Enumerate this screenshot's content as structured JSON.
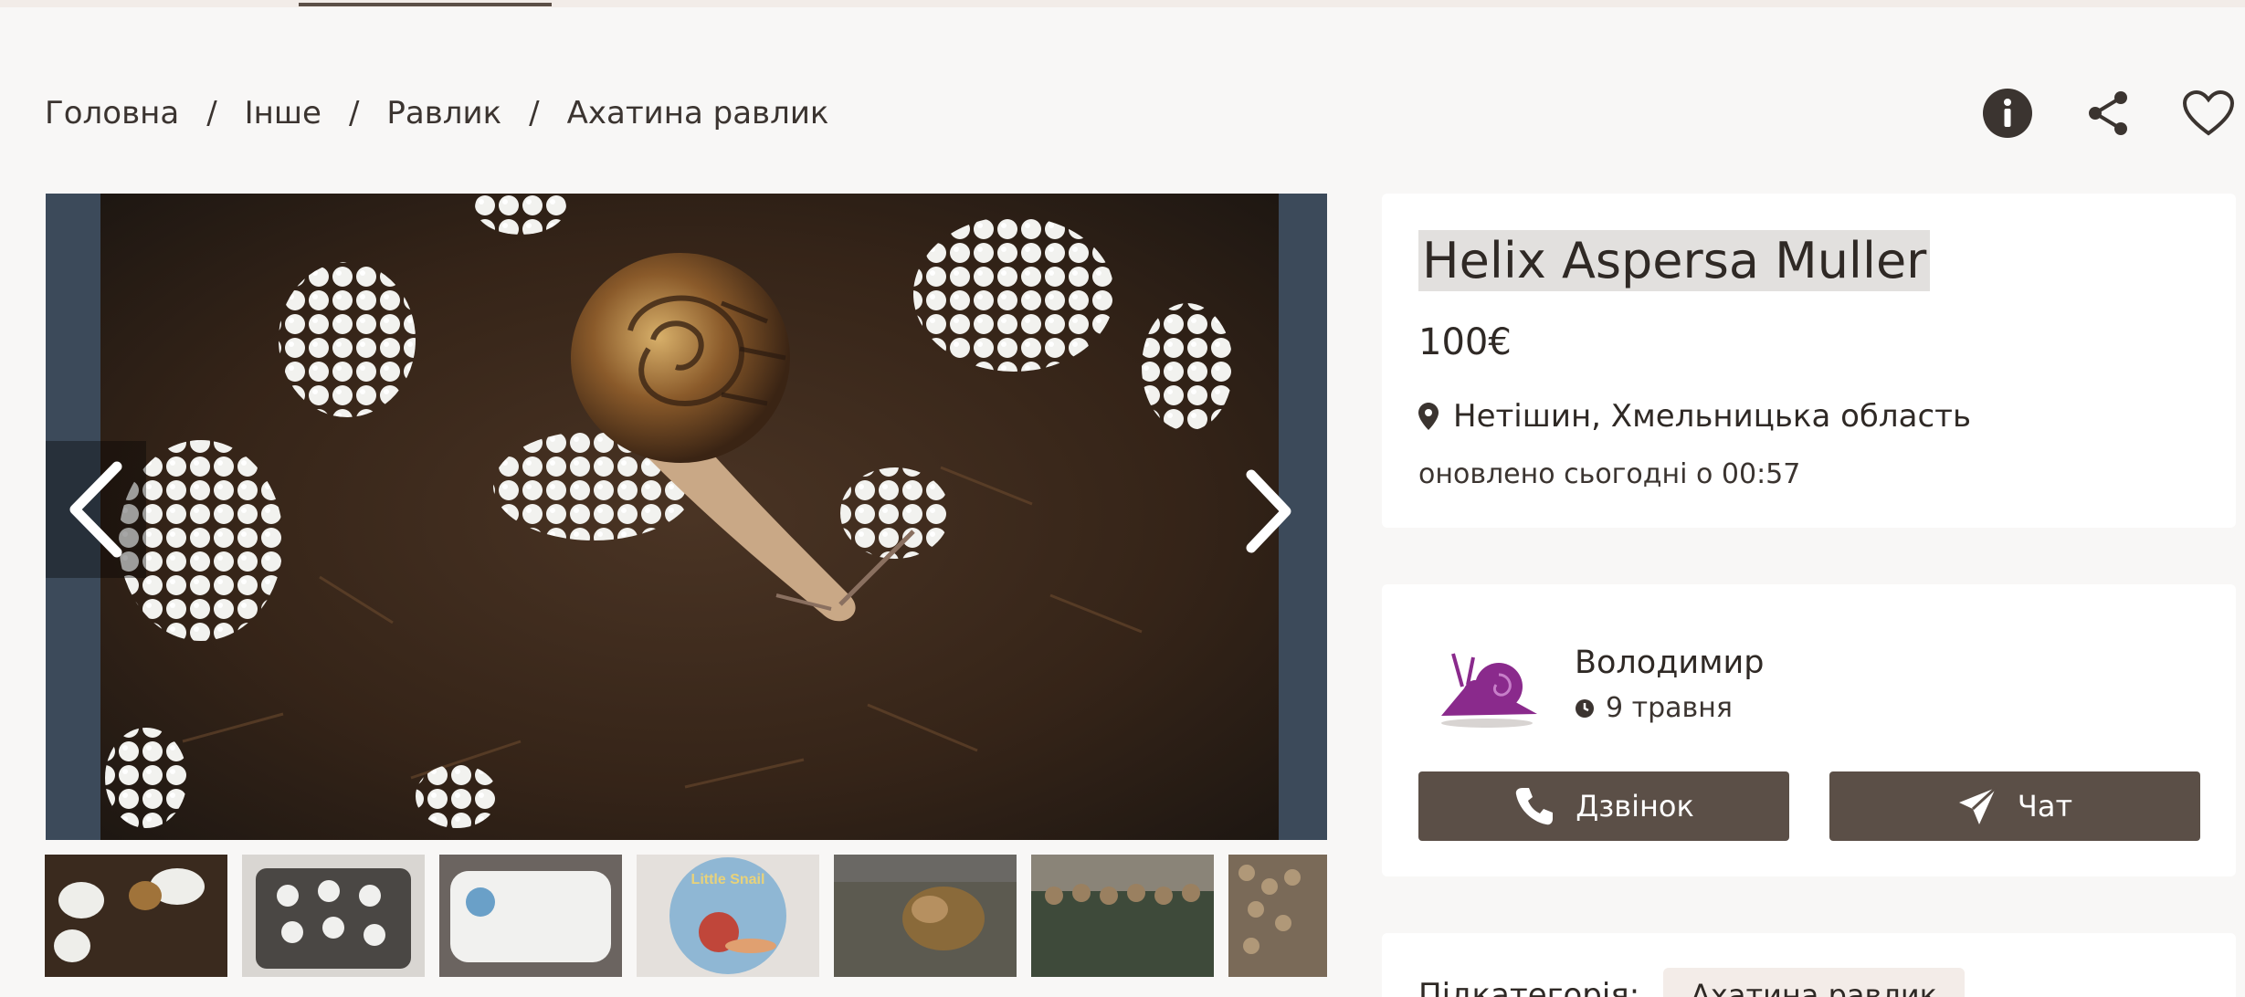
{
  "breadcrumb": [
    "Головна",
    "Інше",
    "Равлик",
    "Ахатина равлик"
  ],
  "icons": {
    "info": "info-icon",
    "share": "share-icon",
    "favorite": "heart-icon",
    "prev": "chevron-left-icon",
    "next": "chevron-right-icon",
    "location": "map-pin-icon",
    "clock": "clock-icon",
    "phone": "phone-icon",
    "chat": "paper-plane-icon"
  },
  "listing": {
    "title": "Helix Aspersa Muller",
    "price": "100€",
    "location": "Нетішин, Хмельницька область",
    "updated": "оновлено сьогодні о 00:57"
  },
  "seller": {
    "name": "Володимир",
    "date": "9 травня",
    "call_label": "Дзвінок",
    "chat_label": "Чат"
  },
  "details": {
    "subcategory_label": "Підкатегорія:",
    "subcategory_value": "Ахатина равлик"
  },
  "thumbnails": [
    {
      "name": "thumbnail-1"
    },
    {
      "name": "thumbnail-2"
    },
    {
      "name": "thumbnail-3"
    },
    {
      "name": "thumbnail-4",
      "text": "Little Snail"
    },
    {
      "name": "thumbnail-5"
    },
    {
      "name": "thumbnail-6"
    },
    {
      "name": "thumbnail-7"
    }
  ],
  "colors": {
    "accent": "#5b4f47",
    "background": "#f8f7f6",
    "card": "#ffffff",
    "chip": "#f3ece8",
    "logo_purple": "#8a2a8c"
  }
}
